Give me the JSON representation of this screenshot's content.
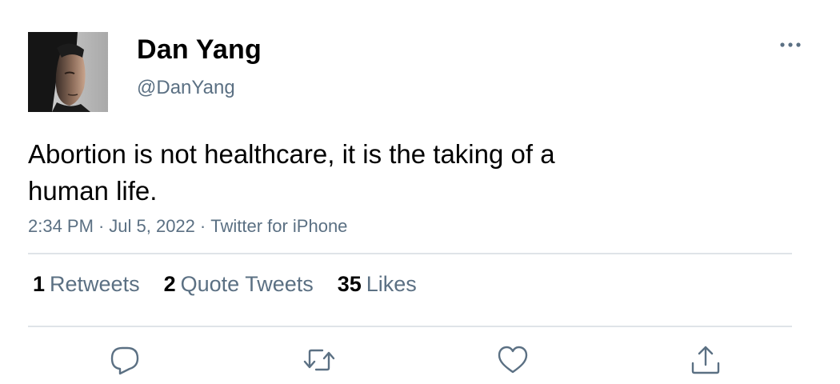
{
  "author": {
    "display_name": "Dan Yang",
    "handle": "@DanYang",
    "avatar_icon": "profile-photo"
  },
  "tweet": {
    "text": "Abortion is not healthcare, it is the taking of a human life.",
    "time": "2:34 PM",
    "date": "Jul 5, 2022",
    "source": "Twitter for iPhone",
    "separator": "·"
  },
  "stats": {
    "retweets": {
      "count": "1",
      "label": "Retweets"
    },
    "quotes": {
      "count": "2",
      "label": "Quote Tweets"
    },
    "likes": {
      "count": "35",
      "label": "Likes"
    }
  },
  "actions": [
    "reply-icon",
    "retweet-icon",
    "like-icon",
    "share-icon"
  ],
  "colors": {
    "secondary_text": "#5b7083",
    "divider": "#dfe4e8",
    "icon": "#5b7083"
  }
}
